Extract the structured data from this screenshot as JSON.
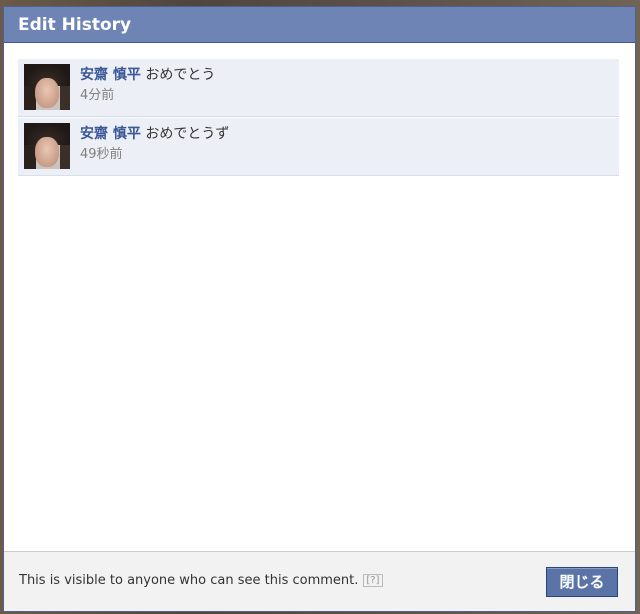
{
  "dialog": {
    "title": "Edit History",
    "close_label": "閉じる",
    "footer_note": "This is visible to anyone who can see this comment.",
    "help_mark": "[?]"
  },
  "history": [
    {
      "author": "安齋 慎平",
      "text": "おめでとう",
      "time": "4分前"
    },
    {
      "author": "安齋 慎平",
      "text": "おめでとうず",
      "time": "49秒前"
    }
  ],
  "colors": {
    "titlebar": "#6d84b4",
    "author_link": "#3b5998",
    "item_background": "#eceff5",
    "button": "#5b74a8"
  },
  "icons": {
    "help": "help-icon",
    "avatar": "profile-photo"
  }
}
